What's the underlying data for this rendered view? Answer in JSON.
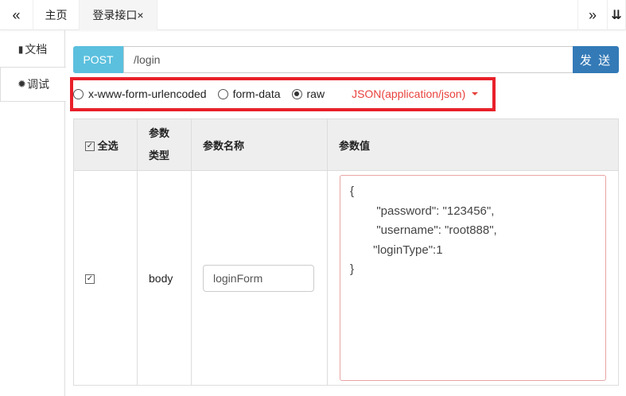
{
  "topbar": {
    "prev": "«",
    "tabs": [
      {
        "label": "主页"
      },
      {
        "label": "登录接口×"
      }
    ],
    "next": "»",
    "menu": "⇊"
  },
  "sidebar": {
    "items": [
      {
        "label": "文档"
      },
      {
        "label": "调试"
      }
    ]
  },
  "request": {
    "method": "POST",
    "url": "/login",
    "send_label": "发 送"
  },
  "body_types": {
    "options": [
      "x-www-form-urlencoded",
      "form-data",
      "raw"
    ],
    "selected": "raw",
    "content_type": "JSON(application/json)"
  },
  "table": {
    "headers": {
      "select_all": "全选",
      "param_type": "参数类型",
      "param_type_l1": "参数",
      "param_type_l2": "类型",
      "param_name": "参数名称",
      "param_value": "参数值"
    },
    "rows": [
      {
        "checked": true,
        "type": "body",
        "name": "loginForm",
        "value": "{\n        \"password\": \"123456\",\n        \"username\": \"root888\",\n       \"loginType\":1\n}"
      }
    ]
  }
}
